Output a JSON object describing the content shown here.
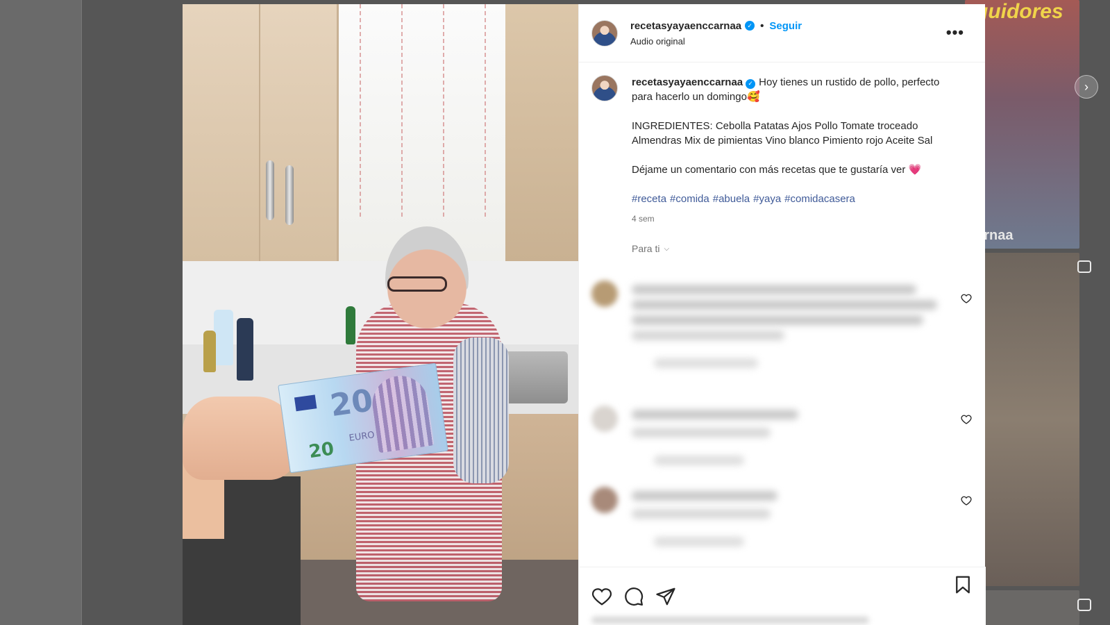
{
  "post": {
    "username": "recetasyayaenccarnaa",
    "follow_label": "Seguir",
    "separator": "•",
    "audio_label": "Audio original",
    "more_label": "•••"
  },
  "caption": {
    "username": "recetasyayaenccarnaa",
    "intro": "Hoy tienes un rustido de pollo, perfecto para hacerlo un domingo🥰",
    "ingredients": "INGREDIENTES: Cebolla Patatas Ajos Pollo Tomate troceado Almendras Mix de pimientas Vino blanco Pimiento rojo Aceite Sal",
    "closing": "Déjame un comentario con más recetas que te gustaría ver 💗",
    "hashtags": [
      "#receta",
      "#comida",
      "#abuela",
      "#yaya",
      "#comidacasera"
    ],
    "age": "4 sem"
  },
  "comments_filter": {
    "label": "Para ti"
  },
  "media": {
    "banknote_value": "20",
    "banknote_currency": "EURO"
  },
  "background": {
    "tile_username_fragment": "carnaa",
    "tile_script_text": "guidores"
  },
  "icons": {
    "verified": "verified-badge-icon",
    "like": "heart-icon",
    "comment": "comment-bubble-icon",
    "share": "paper-plane-icon",
    "save": "bookmark-icon",
    "next": "chevron-right-icon"
  },
  "colors": {
    "accent": "#0095f6",
    "hashtag": "#3f5a98",
    "text": "#262626",
    "muted": "#737373"
  }
}
